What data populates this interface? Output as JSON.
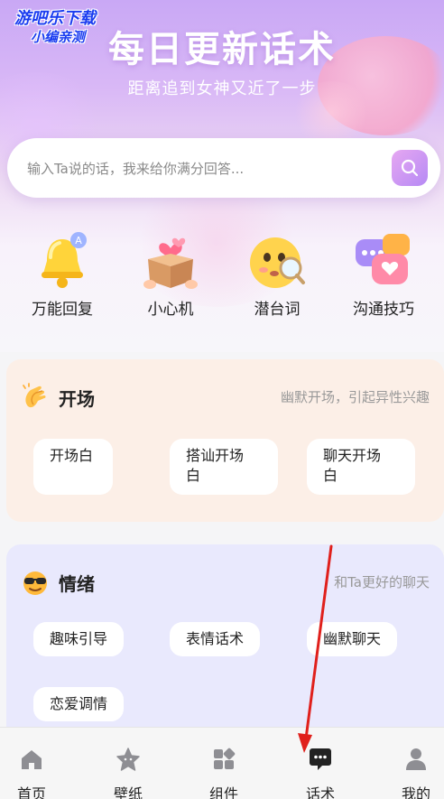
{
  "watermark": {
    "line1": "游吧乐下载",
    "line2": "小编亲测"
  },
  "hero": {
    "title": "每日更新话术",
    "subtitle": "距离追到女神又近了一步"
  },
  "search": {
    "placeholder": "输入Ta说的话，我来给你满分回答..."
  },
  "quick_actions": [
    {
      "label": "万能回复",
      "icon": "bell-icon"
    },
    {
      "label": "小心机",
      "icon": "gift-box-icon"
    },
    {
      "label": "潜台词",
      "icon": "thinking-emoji-icon"
    },
    {
      "label": "沟通技巧",
      "icon": "chat-bubbles-icon"
    }
  ],
  "sections": {
    "opener": {
      "title": "开场",
      "desc": "幽默开场，引起异性兴趣",
      "icon": "clapping-hands-icon",
      "chips": [
        "开场白",
        "搭讪开场\n白",
        "聊天开场\n白"
      ]
    },
    "mood": {
      "title": "情绪",
      "desc": "和Ta更好的聊天",
      "icon": "cool-emoji-icon",
      "chips": [
        "趣味引导",
        "表情话术",
        "幽默聊天",
        "恋爱调情"
      ]
    }
  },
  "tabbar": {
    "items": [
      {
        "label": "首页",
        "icon": "home-icon"
      },
      {
        "label": "壁纸",
        "icon": "star-icon"
      },
      {
        "label": "组件",
        "icon": "widgets-icon"
      },
      {
        "label": "话术",
        "icon": "chat-dots-icon"
      },
      {
        "label": "我的",
        "icon": "profile-icon"
      }
    ]
  },
  "colors": {
    "accent": "#b68af4",
    "opener_bg": "#fcefe7",
    "mood_bg": "#e9e9fd",
    "annotation_arrow": "#e0201c"
  }
}
